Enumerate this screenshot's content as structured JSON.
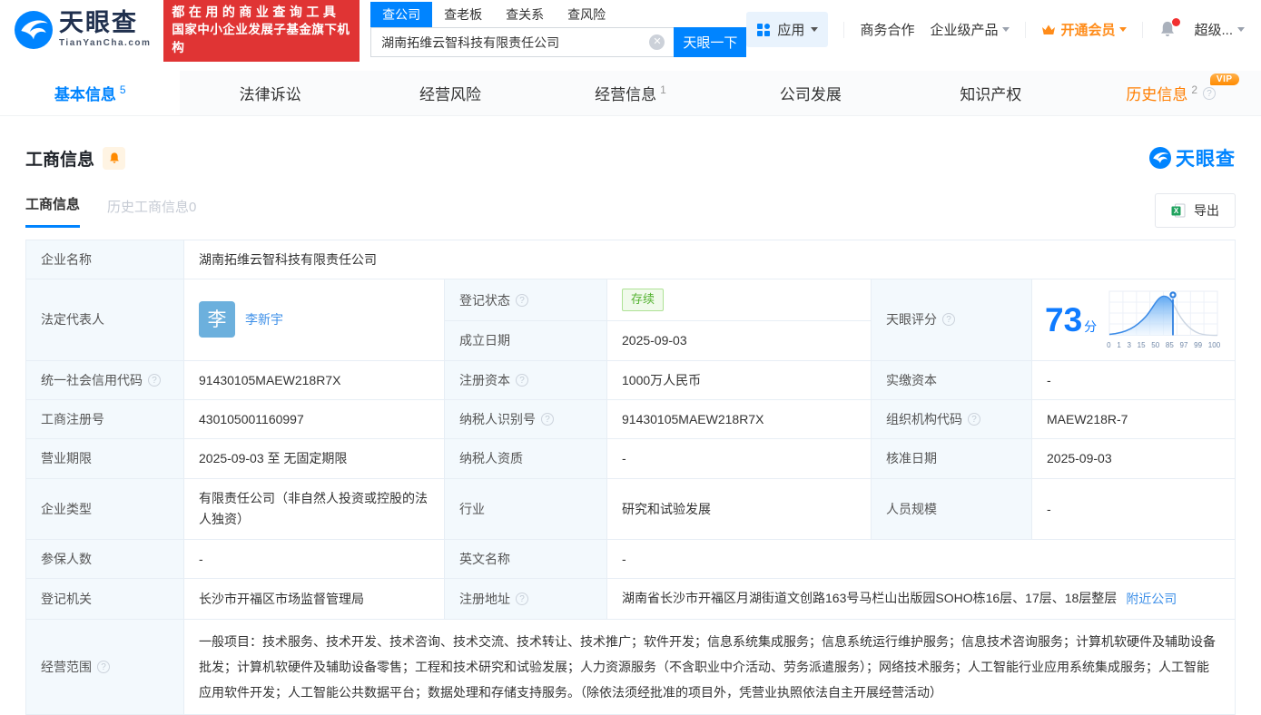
{
  "header": {
    "logo_cn": "天眼查",
    "logo_en": "TianYanCha.com",
    "promo_line1": "都在用的商业查询工具",
    "promo_line2": "国家中小企业发展子基金旗下机构",
    "search_tabs": [
      "查公司",
      "查老板",
      "查关系",
      "查风险"
    ],
    "search_value": "湖南拓维云智科技有限责任公司",
    "search_button": "天眼一下",
    "nav_apps": "应用",
    "nav_biz": "商务合作",
    "nav_enterprise": "企业级产品",
    "nav_vip": "开通会员",
    "nav_super": "超级..."
  },
  "tabs": [
    {
      "label": "基本信息",
      "count": "5"
    },
    {
      "label": "法律诉讼",
      "count": ""
    },
    {
      "label": "经营风险",
      "count": ""
    },
    {
      "label": "经营信息",
      "count": "1"
    },
    {
      "label": "公司发展",
      "count": ""
    },
    {
      "label": "知识产权",
      "count": ""
    },
    {
      "label": "历史信息",
      "count": "2",
      "vip_badge": "VIP"
    }
  ],
  "section": {
    "title": "工商信息",
    "subtab_active": "工商信息",
    "subtab_inactive": "历史工商信息0",
    "export_label": "导出",
    "watermark": "天眼查"
  },
  "table": {
    "company_name_label": "企业名称",
    "company_name": "湖南拓维云智科技有限责任公司",
    "legal_rep_label": "法定代表人",
    "legal_rep_avatar": "李",
    "legal_rep_name": "李新宇",
    "reg_status_label": "登记状态",
    "reg_status": "存续",
    "establish_date_label": "成立日期",
    "establish_date": "2025-09-03",
    "score_label": "天眼评分",
    "score_value": "73",
    "score_unit": "分",
    "score_axis": [
      "0",
      "1",
      "3",
      "15",
      "50",
      "85",
      "97",
      "99",
      "100"
    ],
    "credit_code_label": "统一社会信用代码",
    "credit_code": "91430105MAEW218R7X",
    "reg_capital_label": "注册资本",
    "reg_capital": "1000万人民币",
    "paid_capital_label": "实缴资本",
    "paid_capital": "-",
    "reg_number_label": "工商注册号",
    "reg_number": "430105001160997",
    "taxpayer_id_label": "纳税人识别号",
    "taxpayer_id": "91430105MAEW218R7X",
    "org_code_label": "组织机构代码",
    "org_code": "MAEW218R-7",
    "business_term_label": "营业期限",
    "business_term": "2025-09-03 至 无固定期限",
    "taxpayer_quality_label": "纳税人资质",
    "taxpayer_quality": "-",
    "approval_date_label": "核准日期",
    "approval_date": "2025-09-03",
    "company_type_label": "企业类型",
    "company_type": "有限责任公司（非自然人投资或控股的法人独资）",
    "industry_label": "行业",
    "industry": "研究和试验发展",
    "staff_size_label": "人员规模",
    "staff_size": "-",
    "insured_label": "参保人数",
    "insured": "-",
    "english_name_label": "英文名称",
    "english_name": "-",
    "reg_authority_label": "登记机关",
    "reg_authority": "长沙市开福区市场监督管理局",
    "reg_address_label": "注册地址",
    "reg_address": "湖南省长沙市开福区月湖街道文创路163号马栏山出版园SOHO栋16层、17层、18层整层",
    "nearby_link": "附近公司",
    "business_scope_label": "经营范围",
    "business_scope": "一般项目：技术服务、技术开发、技术咨询、技术交流、技术转让、技术推广；软件开发；信息系统集成服务；信息系统运行维护服务；信息技术咨询服务；计算机软硬件及辅助设备批发；计算机软硬件及辅助设备零售；工程和技术研究和试验发展；人力资源服务（不含职业中介活动、劳务派遣服务）；网络技术服务；人工智能行业应用系统集成服务；人工智能应用软件开发；人工智能公共数据平台；数据处理和存储支持服务。（除依法须经批准的项目外，凭营业执照依法自主开展经营活动）"
  },
  "colors": {
    "brand_blue": "#0084ff",
    "promo_red": "#e03434",
    "vip_orange": "#ff8c1a",
    "status_green": "#54b331",
    "link_blue": "#3d8fe8"
  }
}
